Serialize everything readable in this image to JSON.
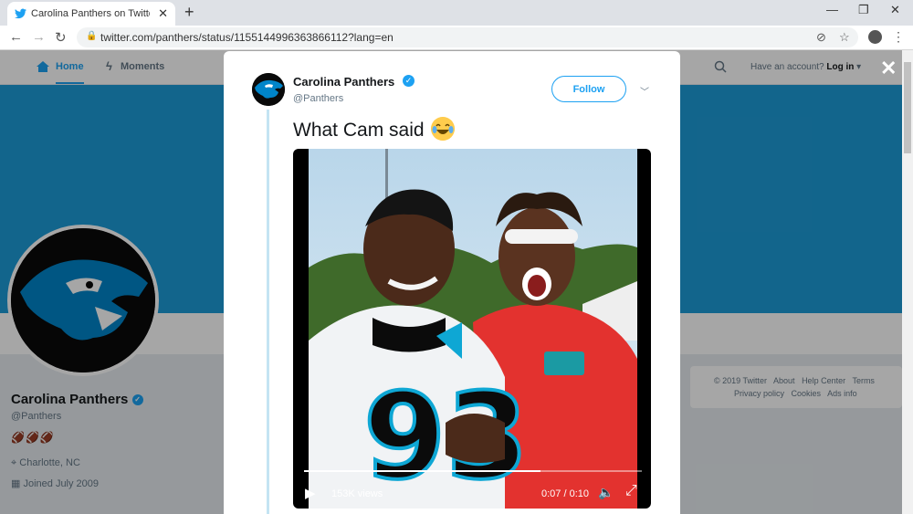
{
  "browser": {
    "tab_title": "Carolina Panthers on Twitter: \"Wh",
    "url": "twitter.com/panthers/status/1155144996363866112?lang=en"
  },
  "twitter_nav": {
    "home": "Home",
    "moments": "Moments",
    "have_account": "Have an account?",
    "login": "Log in"
  },
  "profile": {
    "name": "Carolina Panthers",
    "handle": "@Panthers",
    "emoji": "🏈🏈🏈",
    "location": "Charlotte, NC",
    "joined": "Joined July 2009"
  },
  "footer": {
    "links_row1": [
      "© 2019 Twitter",
      "About",
      "Help Center",
      "Terms"
    ],
    "links_row2": [
      "Privacy policy",
      "Cookies",
      "Ads info"
    ]
  },
  "tweet": {
    "author_name": "Carolina Panthers",
    "author_handle": "@Panthers",
    "follow_label": "Follow",
    "text": "What Cam said",
    "video": {
      "views": "153K views",
      "time": "0:07 / 0:10",
      "progress": 0.7
    }
  },
  "colors": {
    "twitter_blue": "#1da1f2",
    "banner": "#1d9bd7",
    "panthers_blue": "#0085ca"
  }
}
